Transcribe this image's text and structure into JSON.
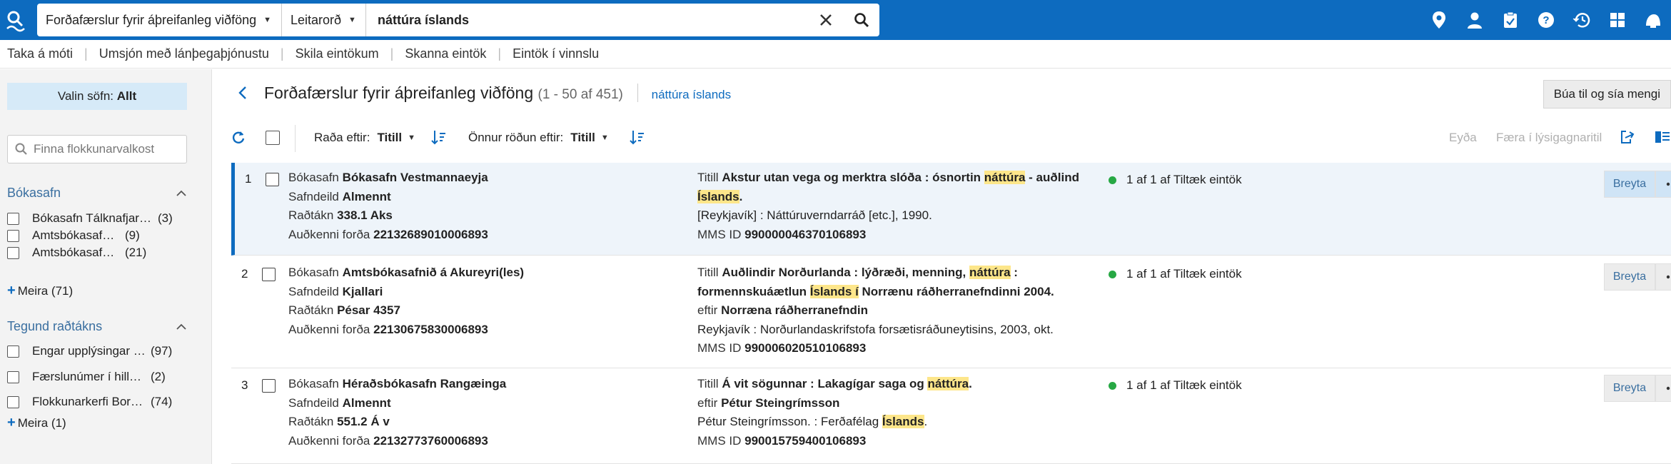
{
  "header": {
    "search_scope": "Forðafærslur fyrir áþreifanleg viðföng",
    "search_field": "Leitarorð",
    "search_query": "náttúra íslands"
  },
  "subnav": [
    "Taka á móti",
    "Umsjón með lánþegaþjónustu",
    "Skila eintökum",
    "Skanna eintök",
    "Eintök í vinnslu"
  ],
  "left": {
    "valin_label": "Valin söfn:",
    "valin_value": "Allt",
    "filter_placeholder": "Finna flokkunarvalkost",
    "facets": [
      {
        "title": "Bókasafn",
        "items": [
          {
            "label": "Bókasafn Tálknafjarðar",
            "count": "(3)"
          },
          {
            "label": "Amtsbókasafnið á Akureyri",
            "count": "(9)"
          },
          {
            "label": "Amtsbókasafnið á Akureyri",
            "count": "(21)"
          }
        ],
        "more": "Meira (71)"
      },
      {
        "title": "Tegund raðtákns",
        "items": [
          {
            "label": "Engar upplýsingar gefnar",
            "count": "(97)"
          },
          {
            "label": "Færslunúmer í hillurööð",
            "count": "(2)"
          },
          {
            "label": "Flokkunarkerfi Borgarbókasafns",
            "count": "(74)"
          }
        ],
        "more": "Meira (1)"
      }
    ]
  },
  "main": {
    "title": "Forðafærslur fyrir áþreifanleg viðföng",
    "count": "(1 - 50 af 451)",
    "query": "náttúra íslands",
    "create_set": "Búa til og sía mengi",
    "sort_label": "Raða eftir:",
    "sort_value": "Titill",
    "sort2_label": "Önnur röðun eftir:",
    "sort2_value": "Titill",
    "delete": "Eyða",
    "move": "Færa í lýsigagnaritil"
  },
  "labels": {
    "bokasafn": "Bókasafn",
    "safndeild": "Safndeild",
    "radtakn": "Raðtákn",
    "audkenni": "Auðkenni forða",
    "titill": "Titill",
    "eftir": "eftir",
    "mms": "MMS ID",
    "edit": "Breyta"
  },
  "results": [
    {
      "num": "1",
      "library": "Bókasafn Vestmannaeyja",
      "location": "Almennt",
      "callnum": "338.1 Aks",
      "holding_id": "22132689010006893",
      "title_a": "Akstur utan vega og merktra slóða : ósnortin ",
      "title_hl1": "náttúra",
      "title_b": " - auðlind",
      "title_hl2": "Íslands",
      "title_c": ".",
      "publication": "[Reykjavík] : Náttúruverndarráð [etc.], 1990.",
      "mms": "990000046370106893",
      "status": "1 af 1 af Tiltæk eintök"
    },
    {
      "num": "2",
      "library": "Amtsbókasafnið á Akureyri(les)",
      "location": "Kjallari",
      "callnum": "Pésar 4357",
      "holding_id": "22130675830006893",
      "title_a": "Auðlindir Norðurlanda : lýðræði, menning, ",
      "title_hl1": "náttúra",
      "title_b": " :",
      "title_c": "formennskuáætlun ",
      "title_hl2": "Íslands",
      "title_d": " í",
      "title_e": " Norrænu ráðherranefndinni 2004.",
      "author": "Norræna ráðherranefndin",
      "publication": "Reykjavík : Norðurlandaskrifstofa forsætisráðuneytisins, 2003, okt.",
      "mms": "990006020510106893",
      "status": "1 af 1 af Tiltæk eintök"
    },
    {
      "num": "3",
      "library": "Héraðsbókasafn Rangæinga",
      "location": "Almennt",
      "callnum": "551.2 Á v",
      "holding_id": "22132773760006893",
      "title_a": "Á vit sögunnar : Lakagígar saga og ",
      "title_hl1": "náttúra",
      "title_b": ".",
      "author": "Pétur Steingrímsson",
      "pub_a": "Pétur Steingrímsson. : Ferðafélag ",
      "pub_hl": "Íslands",
      "pub_b": ".",
      "mms": "990015759400106893",
      "status": "1 af 1 af Tiltæk eintök"
    }
  ]
}
